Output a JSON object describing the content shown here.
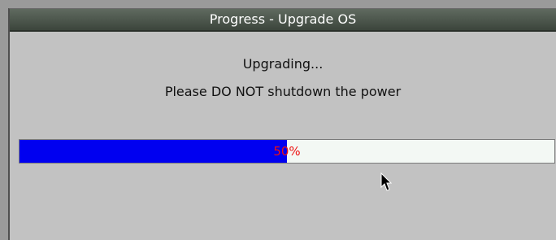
{
  "dialog": {
    "title": "Progress - Upgrade OS",
    "message_line1": "Upgrading...",
    "message_line2": "Please DO NOT shutdown the power"
  },
  "progress": {
    "value": 0.5,
    "label": "50%",
    "fill_color": "#0000f0",
    "text_color": "#ee1111"
  },
  "icons": {
    "cursor": "mouse-pointer-icon"
  }
}
